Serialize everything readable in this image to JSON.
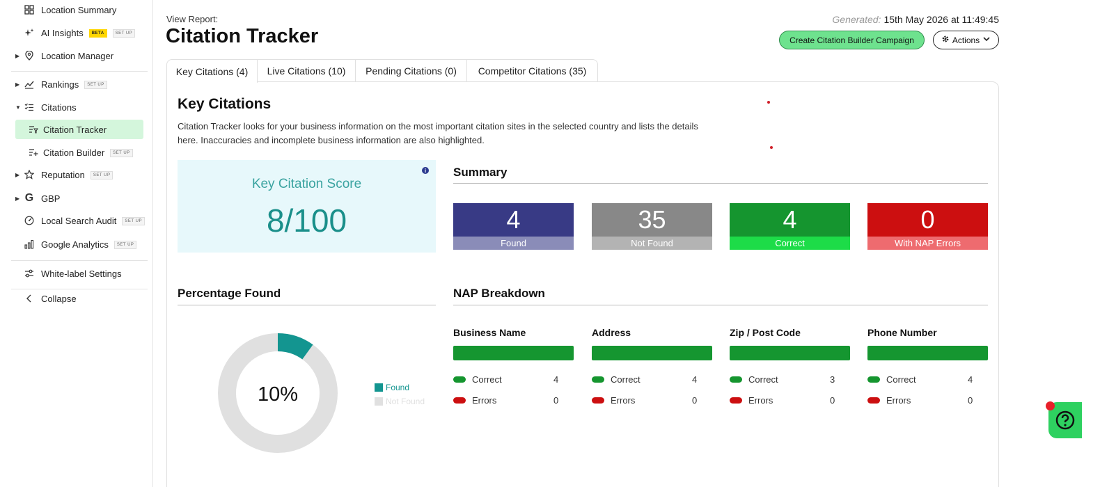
{
  "sidebar": {
    "items": [
      {
        "label": "Location Summary"
      },
      {
        "label": "AI Insights",
        "tag": "BETA",
        "tag2": "SET UP"
      },
      {
        "label": "Location Manager"
      },
      {
        "label": "Rankings",
        "tag": "SET UP"
      },
      {
        "label": "Citations"
      },
      {
        "label": "Citation Tracker"
      },
      {
        "label": "Citation Builder",
        "tag": "SET UP"
      },
      {
        "label": "Reputation",
        "tag": "SET UP"
      },
      {
        "label": "GBP"
      },
      {
        "label": "Local Search Audit",
        "tag": "SET UP"
      },
      {
        "label": "Google Analytics",
        "tag": "SET UP"
      },
      {
        "label": "White-label Settings"
      },
      {
        "label": "Collapse"
      }
    ]
  },
  "header": {
    "view_report_label": "View Report:",
    "title": "Citation Tracker",
    "generated_label": "Generated:",
    "generated_value": "15th May 2026 at 11:49:45",
    "create_button": "Create Citation Builder Campaign",
    "actions_button": "Actions"
  },
  "tabs": [
    {
      "label": "Key Citations (4)"
    },
    {
      "label": "Live Citations (10)"
    },
    {
      "label": "Pending Citations (0)"
    },
    {
      "label": "Competitor Citations (35)"
    }
  ],
  "main": {
    "section_title": "Key Citations",
    "description": "Citation Tracker looks for your business information on the most important citation sites in the selected country and lists the details here. Inaccuracies and incomplete business information are also highlighted.",
    "score": {
      "label": "Key Citation Score",
      "value": "8/100"
    },
    "summary": {
      "title": "Summary",
      "stats": [
        {
          "value": "4",
          "label": "Found",
          "color": "#383a85",
          "cap_color": "#8a8cb8"
        },
        {
          "value": "35",
          "label": "Not Found",
          "color": "#888888",
          "cap_color": "#b3b3b3"
        },
        {
          "value": "4",
          "label": "Correct",
          "color": "#15952f",
          "cap_color": "#1ddc48"
        },
        {
          "value": "0",
          "label": "With NAP Errors",
          "color": "#cc0f10",
          "cap_color": "#ee6b6f"
        }
      ]
    },
    "percentage": {
      "title": "Percentage Found",
      "center_label": "10%",
      "found_fraction": 0.1,
      "legend": [
        {
          "label": "Found",
          "color": "#139590"
        },
        {
          "label": "Not Found",
          "color": "#e0e0e0"
        }
      ]
    },
    "nap": {
      "title": "NAP Breakdown",
      "correct_label": "Correct",
      "errors_label": "Errors",
      "correct_color": "#15952f",
      "errors_color": "#cc0f10",
      "columns": [
        {
          "title": "Business Name",
          "correct": "4",
          "errors": "0"
        },
        {
          "title": "Address",
          "correct": "4",
          "errors": "0"
        },
        {
          "title": "Zip / Post Code",
          "correct": "3",
          "errors": "0"
        },
        {
          "title": "Phone Number",
          "correct": "4",
          "errors": "0"
        }
      ]
    }
  }
}
